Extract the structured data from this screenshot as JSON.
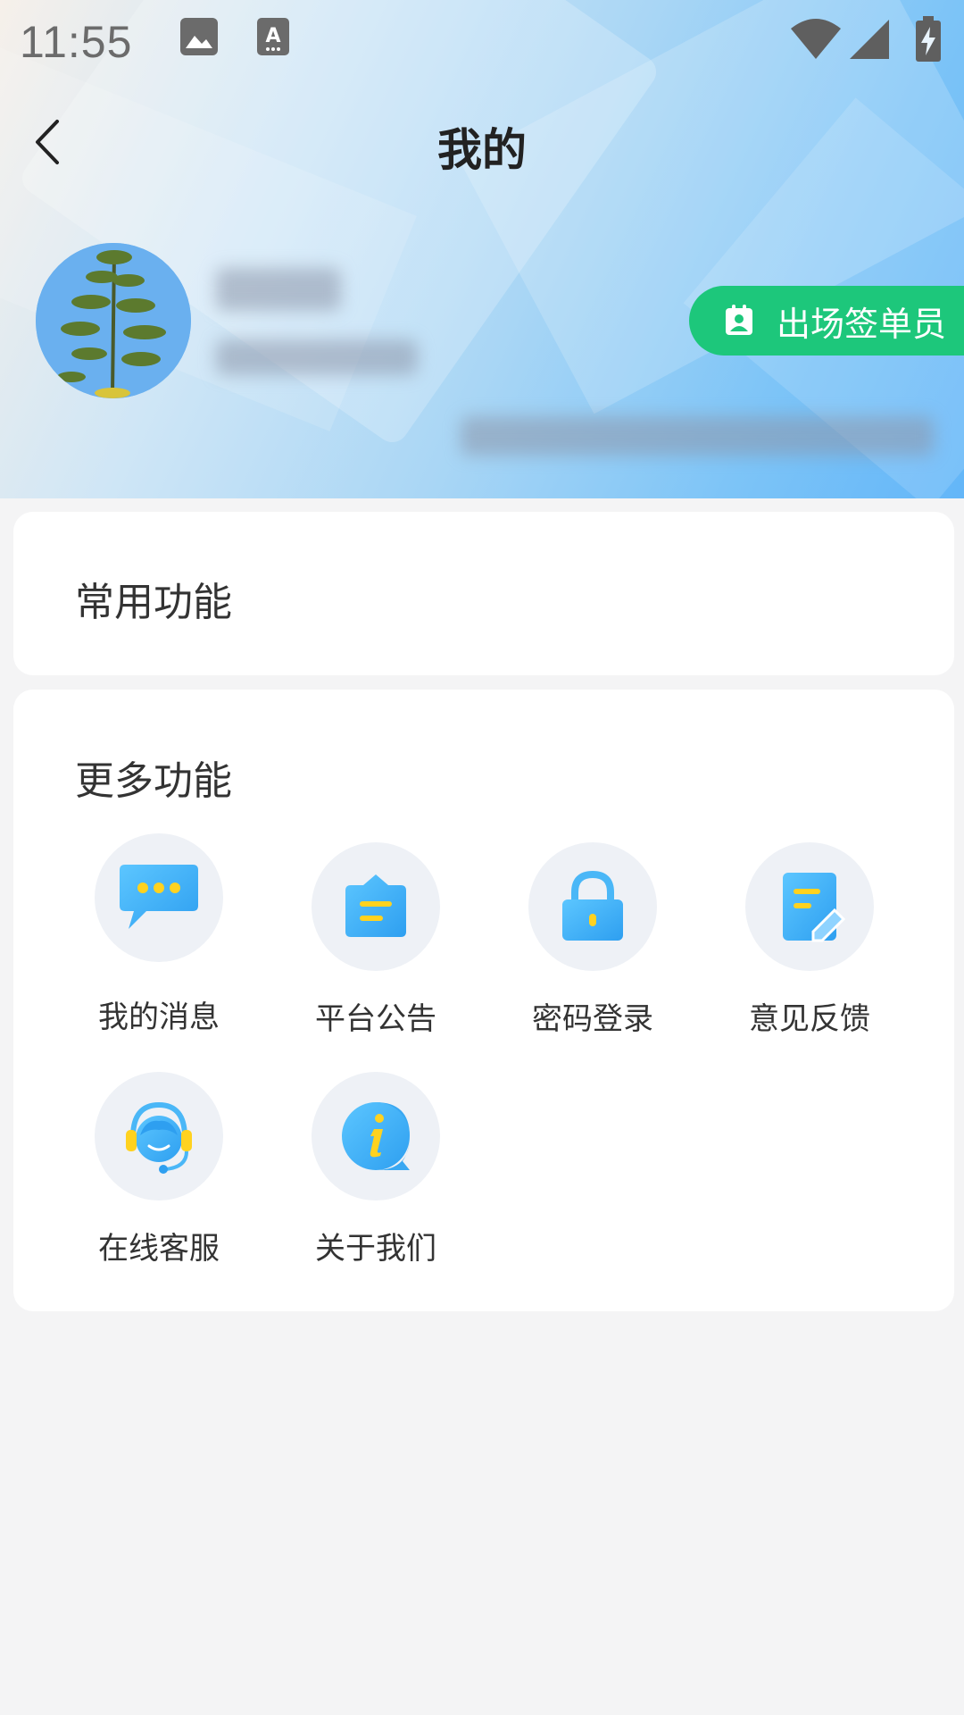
{
  "status_bar": {
    "time": "11:55"
  },
  "header": {
    "back_icon": "chevron-left-icon",
    "title": "我的"
  },
  "profile": {
    "sign_chip_label": "出场签单员",
    "sign_chip_icon": "badge-icon"
  },
  "common_functions": {
    "title": "常用功能"
  },
  "more_functions": {
    "title": "更多功能",
    "items": [
      {
        "label": "我的消息",
        "icon": "chat-bubble-icon"
      },
      {
        "label": "平台公告",
        "icon": "announcement-icon"
      },
      {
        "label": "密码登录",
        "icon": "lock-icon"
      },
      {
        "label": "意见反馈",
        "icon": "feedback-edit-icon"
      },
      {
        "label": "在线客服",
        "icon": "customer-service-icon"
      },
      {
        "label": "关于我们",
        "icon": "info-icon"
      }
    ]
  },
  "colors": {
    "accent_green": "#1dc77b",
    "icon_blue": "#40aff5",
    "icon_yellow": "#ffd21f"
  }
}
